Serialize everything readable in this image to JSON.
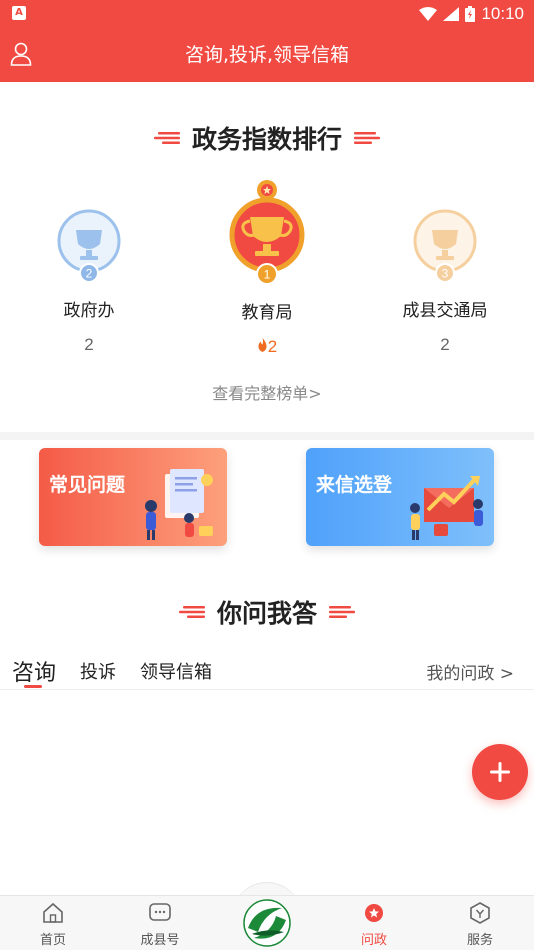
{
  "status_bar": {
    "time": "10:10",
    "app_icon_letter": "A"
  },
  "header": {
    "title": "咨询,投诉,领导信箱"
  },
  "ranking": {
    "title": "政务指数排行",
    "items": [
      {
        "rank": "2",
        "name": "政府办",
        "score": "2"
      },
      {
        "rank": "1",
        "name": "教育局",
        "score": "2"
      },
      {
        "rank": "3",
        "name": "成县交通局",
        "score": "2"
      }
    ],
    "full_list_link": "查看完整榜单>"
  },
  "cards": {
    "faq": "常见问题",
    "letters": "来信选登"
  },
  "qa": {
    "title": "你问我答",
    "tabs": [
      "咨询",
      "投诉",
      "领导信箱"
    ],
    "active_tab": "咨询",
    "my_link": "我的问政 >"
  },
  "bottom_nav": {
    "items": [
      {
        "label": "首页",
        "icon": "home-icon"
      },
      {
        "label": "成县号",
        "icon": "chat-icon"
      },
      {
        "label": "问政",
        "icon": "ask-icon",
        "active": true
      },
      {
        "label": "服务",
        "icon": "service-icon"
      }
    ],
    "center_icon": "app-logo"
  },
  "colors": {
    "brand": "#f04a42",
    "gold": "#f0a12b",
    "silver": "#8fb8e8",
    "bronze": "#f5cf9e"
  }
}
